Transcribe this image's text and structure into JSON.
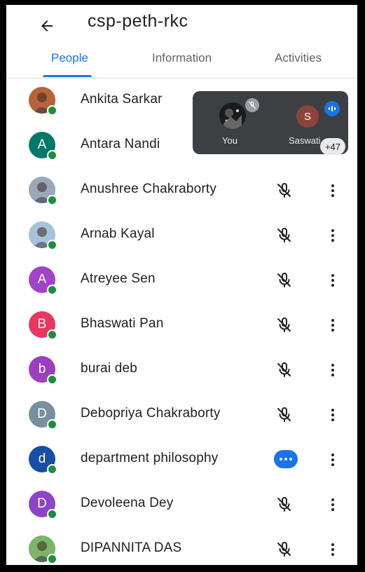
{
  "header": {
    "title": "csp-peth-rkc"
  },
  "tabs": [
    {
      "label": "People",
      "active": true
    },
    {
      "label": "Information",
      "active": false
    },
    {
      "label": "Activities",
      "active": false
    }
  ],
  "colors": {
    "accent": "#1a73e8",
    "online": "#1e8e3e",
    "tray": "#3c4043"
  },
  "participants": [
    {
      "name": "Ankita Sarkar",
      "initial": "",
      "avatar_color": "#b5643c",
      "photo": true,
      "status_icon": "mic-off-icon"
    },
    {
      "name": "Antara Nandi",
      "initial": "A",
      "avatar_color": "#00796b",
      "photo": false,
      "status_icon": "mic-off-icon"
    },
    {
      "name": "Anushree Chakraborty",
      "initial": "",
      "avatar_color": "#9aa8b8",
      "photo": true,
      "status_icon": "mic-off-icon"
    },
    {
      "name": "Arnab Kayal",
      "initial": "",
      "avatar_color": "#a6c4d8",
      "photo": true,
      "status_icon": "mic-off-icon"
    },
    {
      "name": "Atreyee Sen",
      "initial": "A",
      "avatar_color": "#a142c8",
      "photo": false,
      "status_icon": "mic-off-icon"
    },
    {
      "name": "Bhaswati Pan",
      "initial": "B",
      "avatar_color": "#e8375f",
      "photo": false,
      "status_icon": "mic-off-icon"
    },
    {
      "name": "burai deb",
      "initial": "b",
      "avatar_color": "#9c3fbf",
      "photo": false,
      "status_icon": "mic-off-icon"
    },
    {
      "name": "Debopriya Chakraborty",
      "initial": "D",
      "avatar_color": "#78909c",
      "photo": false,
      "status_icon": "mic-off-icon"
    },
    {
      "name": "department philosophy",
      "initial": "d",
      "avatar_color": "#174ea6",
      "photo": false,
      "status_icon": "more-dots-icon"
    },
    {
      "name": "Devoleena Dey",
      "initial": "D",
      "avatar_color": "#8e44c8",
      "photo": false,
      "status_icon": "mic-off-icon"
    },
    {
      "name": "DIPANNITA DAS",
      "initial": "",
      "avatar_color": "#7cb46a",
      "photo": true,
      "status_icon": "mic-off-icon"
    }
  ],
  "tray": {
    "you_label": "You",
    "speaker_initial": "S",
    "speaker_label": "Saswati",
    "more_count": "+47"
  }
}
